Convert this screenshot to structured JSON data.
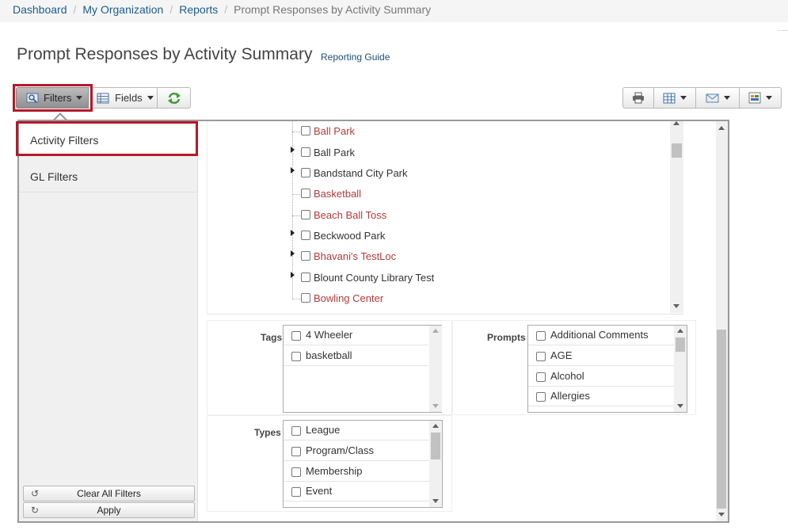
{
  "breadcrumb": {
    "items": [
      "Dashboard",
      "My Organization",
      "Reports"
    ],
    "current": "Prompt Responses by Activity Summary",
    "separator": "/"
  },
  "page": {
    "title": "Prompt Responses by Activity Summary",
    "guide_link": "Reporting Guide"
  },
  "toolbar": {
    "filters_label": "Filters",
    "fields_label": "Fields",
    "right_buttons": [
      "print-icon",
      "grid-icon",
      "email-icon",
      "export-icon"
    ]
  },
  "sidebar": {
    "items": [
      {
        "label": "Activity Filters",
        "active": true
      },
      {
        "label": "GL Filters",
        "active": false
      }
    ],
    "clear_label": "Clear All Filters",
    "apply_label": "Apply"
  },
  "tree": {
    "items": [
      {
        "label": "Ball Park",
        "expandable": false,
        "linked": true
      },
      {
        "label": "Ball Park",
        "expandable": true,
        "linked": false
      },
      {
        "label": "Bandstand City Park",
        "expandable": true,
        "linked": false
      },
      {
        "label": "Basketball",
        "expandable": false,
        "linked": true
      },
      {
        "label": "Beach Ball Toss",
        "expandable": false,
        "linked": true
      },
      {
        "label": "Beckwood Park",
        "expandable": true,
        "linked": false
      },
      {
        "label": "Bhavani's TestLoc",
        "expandable": true,
        "linked": true
      },
      {
        "label": "Blount County Library Test",
        "expandable": true,
        "linked": false
      },
      {
        "label": "Bowling Center",
        "expandable": false,
        "linked": true
      }
    ]
  },
  "tags": {
    "label": "Tags",
    "items": [
      "4 Wheeler",
      "basketball"
    ]
  },
  "prompts": {
    "label": "Prompts",
    "items": [
      "Additional Comments",
      "AGE",
      "Alcohol",
      "Allergies"
    ]
  },
  "types": {
    "label": "Types",
    "items": [
      "League",
      "Program/Class",
      "Membership",
      "Event"
    ]
  },
  "colors": {
    "highlight": "#b5182b",
    "link_red": "#b33a3a",
    "link_blue": "#1c5c8c"
  }
}
